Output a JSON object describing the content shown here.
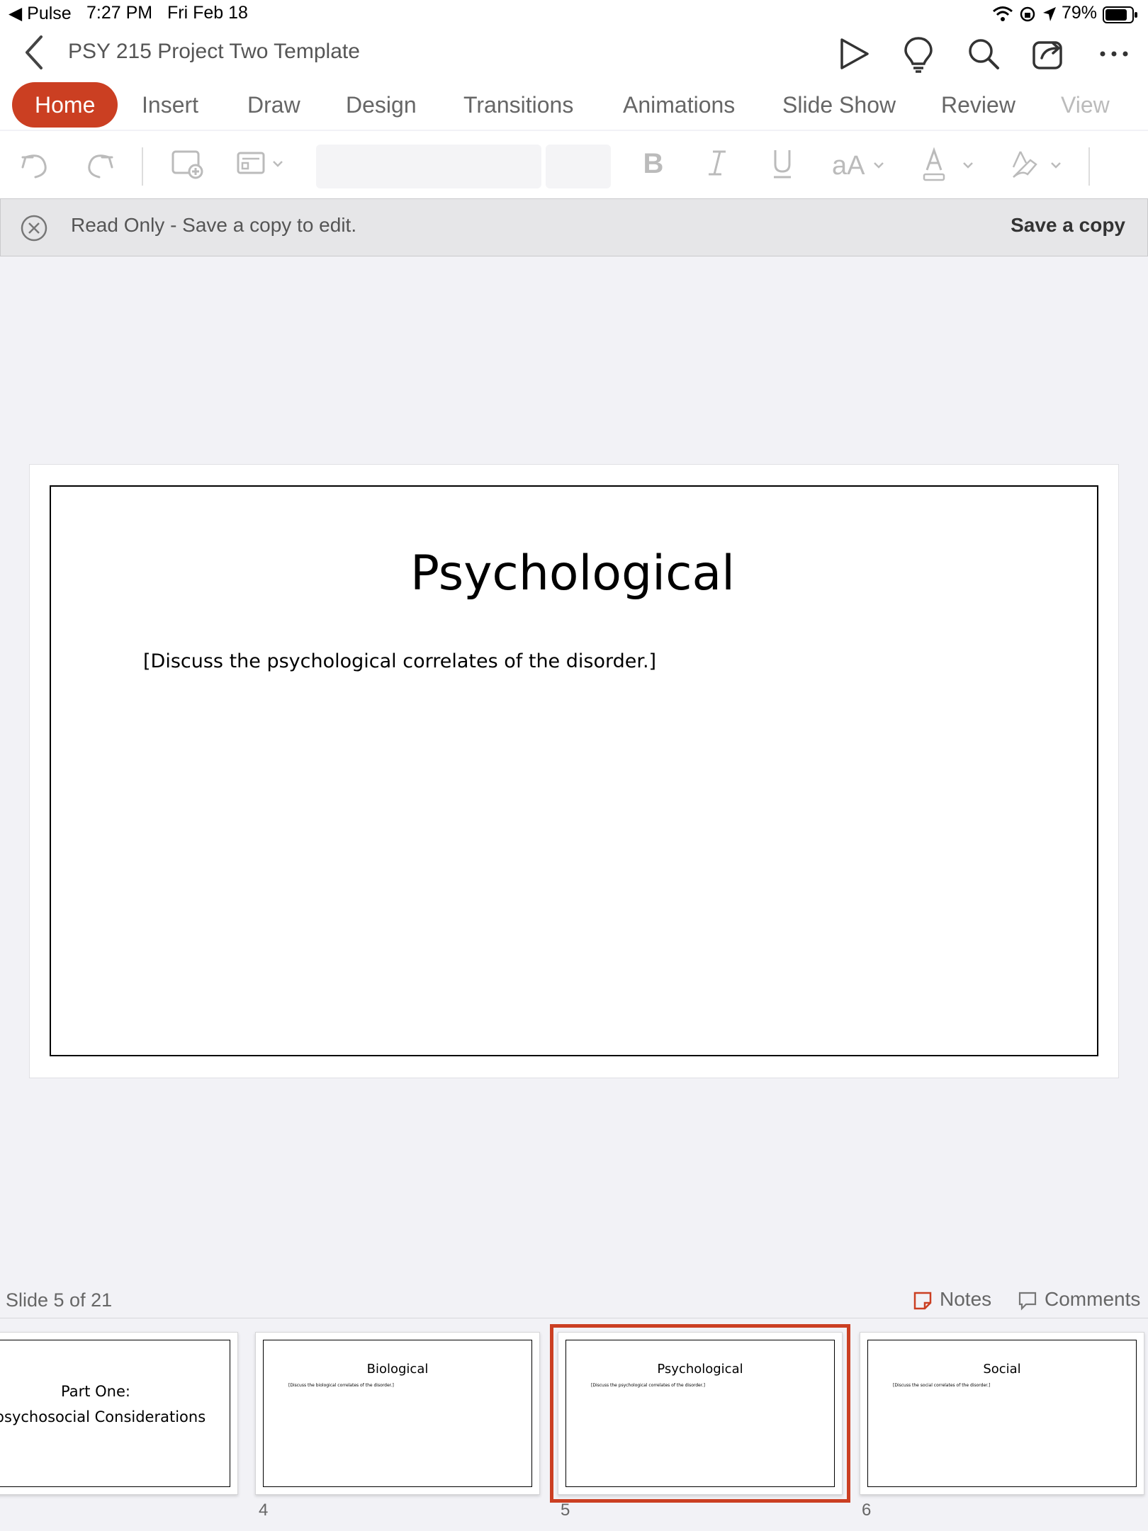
{
  "status_bar": {
    "back_app": "◀ Pulse",
    "time": "7:27 PM",
    "date": "Fri Feb 18",
    "battery": "79%"
  },
  "title_bar": {
    "document_title": "PSY 215 Project Two Template"
  },
  "ribbon": {
    "tabs": [
      "Home",
      "Insert",
      "Draw",
      "Design",
      "Transitions",
      "Animations",
      "Slide Show",
      "Review",
      "View"
    ],
    "active_tab": "Home"
  },
  "read_only_bar": {
    "message": "Read Only - Save a copy to edit.",
    "action": "Save a copy"
  },
  "slide": {
    "title": "Psychological",
    "body": "[Discuss the psychological correlates of the disorder.]"
  },
  "footer": {
    "slide_counter": "Slide 5 of 21",
    "notes_label": "Notes",
    "comments_label": "Comments"
  },
  "thumbnails": [
    {
      "title": "Part One:",
      "subtitle": "opsychosocial Considerations",
      "number": ""
    },
    {
      "title": "Biological",
      "body": "[Discuss the biological correlates of the disorder.]",
      "number": "4"
    },
    {
      "title": "Psychological",
      "body": "[Discuss the psychological correlates of the disorder.]",
      "number": "5"
    },
    {
      "title": "Social",
      "body": "[Discuss the social correlates of the disorder.]",
      "number": "6"
    }
  ],
  "colors": {
    "accent": "#cb3f22",
    "background": "#f2f2f6"
  }
}
